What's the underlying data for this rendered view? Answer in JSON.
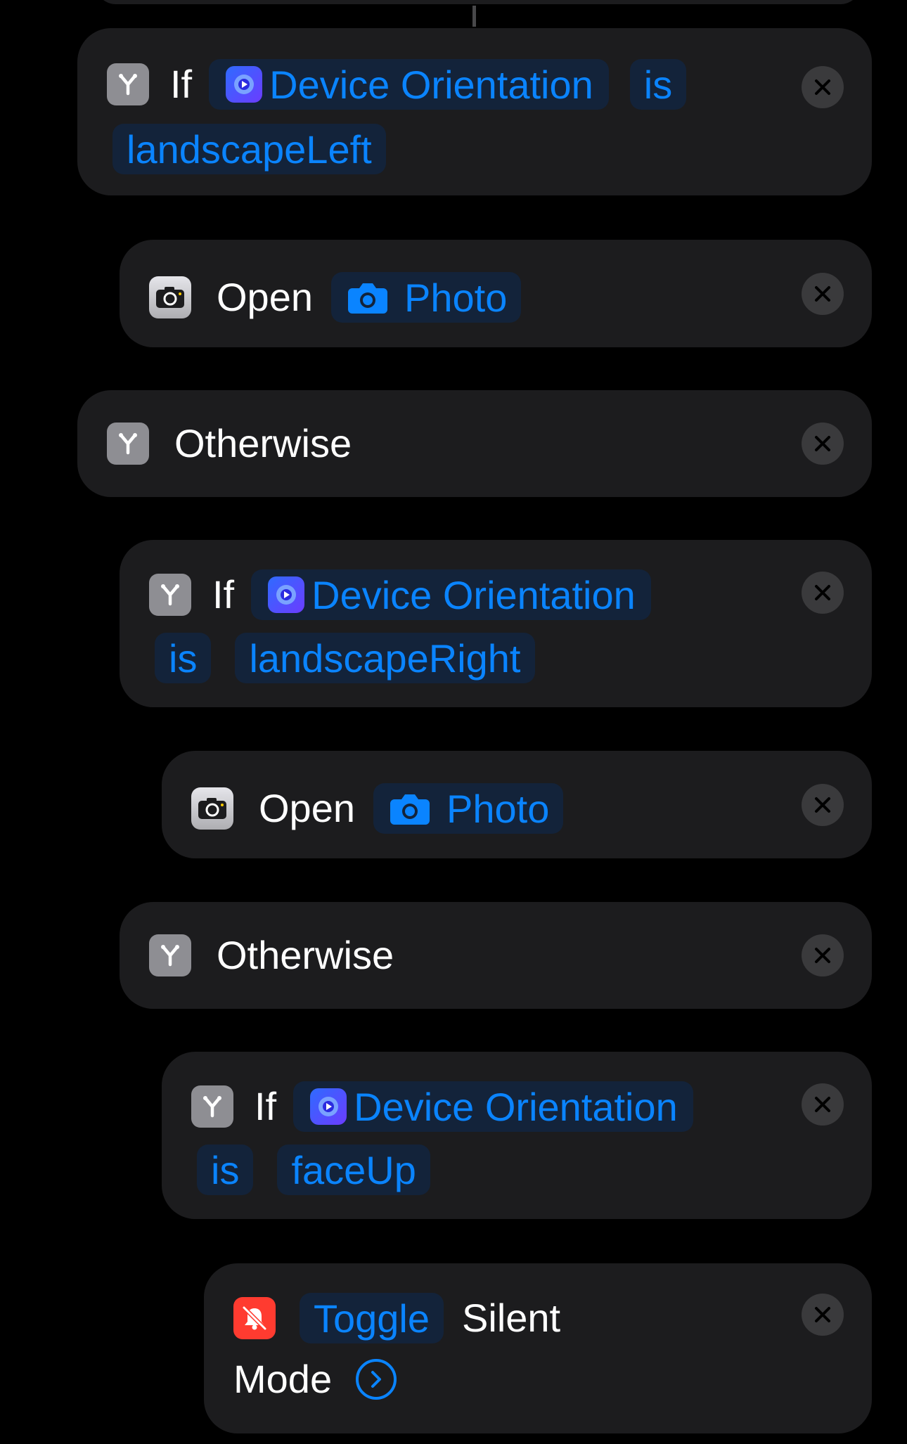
{
  "actions": [
    {
      "type": "if",
      "keyword": "If",
      "variable": "Device Orientation",
      "operator": "is",
      "value": "landscapeLeft"
    },
    {
      "type": "open",
      "verb": "Open",
      "target": "Photo"
    },
    {
      "type": "otherwise",
      "label": "Otherwise"
    },
    {
      "type": "if",
      "keyword": "If",
      "variable": "Device Orientation",
      "operator": "is",
      "value": "landscapeRight"
    },
    {
      "type": "open",
      "verb": "Open",
      "target": "Photo"
    },
    {
      "type": "otherwise",
      "label": "Otherwise"
    },
    {
      "type": "if",
      "keyword": "If",
      "variable": "Device Orientation",
      "operator": "is",
      "value": "faceUp"
    },
    {
      "type": "toggle",
      "verb": "Toggle",
      "text1": "Silent",
      "text2": "Mode"
    }
  ],
  "icons": {
    "branch": "branch-icon",
    "camera_app": "camera-app-icon",
    "camera": "camera-icon",
    "orientation": "device-orientation-icon",
    "silent": "silent-mode-icon",
    "close": "close-icon",
    "chevron": "chevron-right-circle-icon"
  },
  "colors": {
    "background": "#000000",
    "card": "#1c1c1e",
    "accent": "#0a84ff",
    "pill": "#13233a",
    "branch_icon": "#8e8e93",
    "silent_icon": "#ff3b30"
  }
}
